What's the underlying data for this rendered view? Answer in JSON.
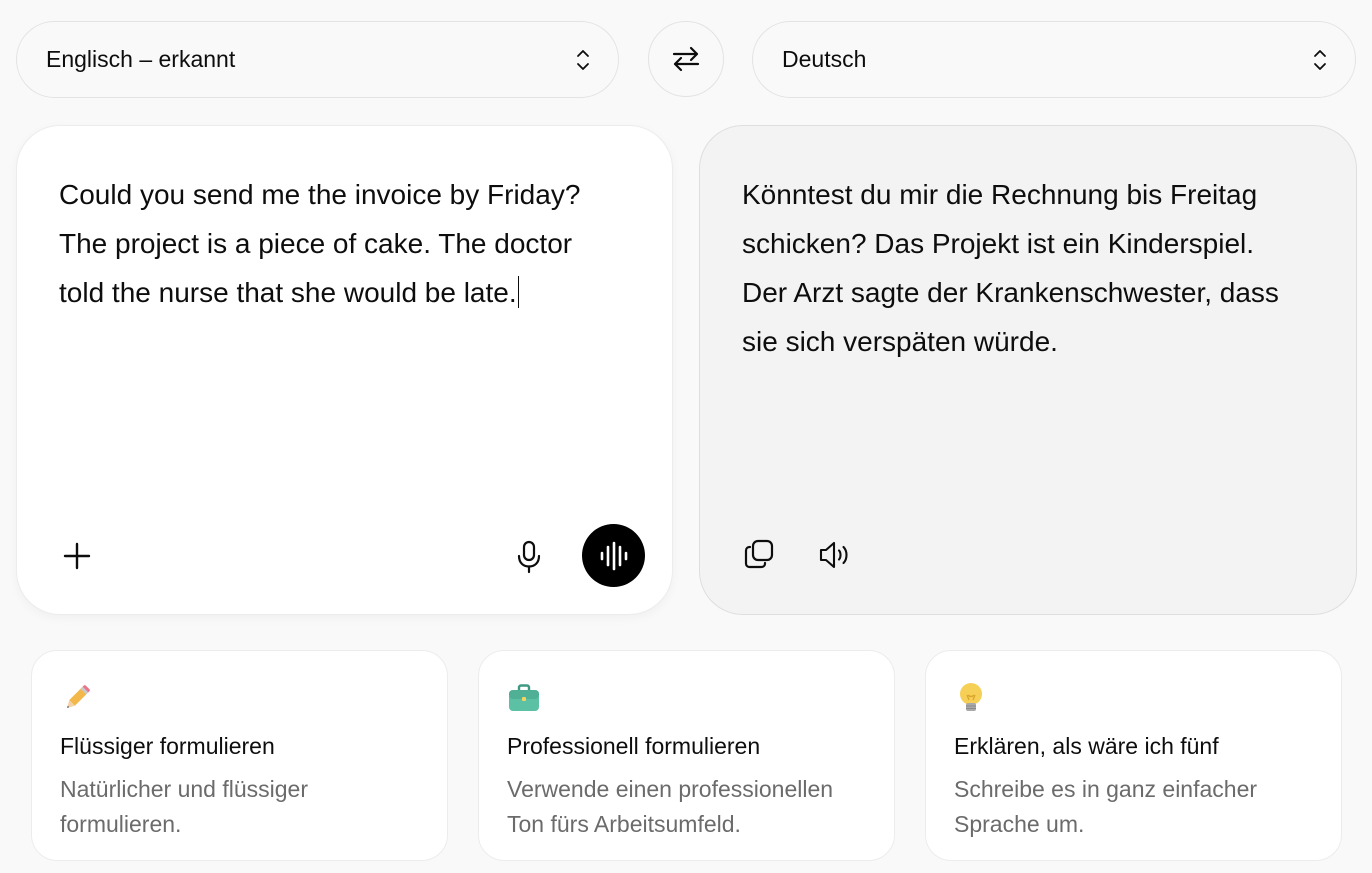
{
  "source_language": {
    "label": "Englisch – erkannt",
    "icon": "chevron-up-down-icon"
  },
  "target_language": {
    "label": "Deutsch",
    "icon": "chevron-up-down-icon"
  },
  "swap": {
    "icon": "swap-arrows-icon"
  },
  "source_panel": {
    "text": "Could you send me the invoice by Friday?\nThe project is a piece of cake. The doctor\ntold the nurse that she would be late.",
    "icons": [
      "plus-icon",
      "microphone-icon",
      "voice-waveform-icon"
    ]
  },
  "target_panel": {
    "text": "Könntest du mir die Rechnung bis Freitag\nschicken? Das Projekt ist ein Kinderspiel.\nDer Arzt sagte der Krankenschwester, dass\nsie sich verspäten würde.",
    "icons": [
      "copy-icon",
      "speaker-icon"
    ]
  },
  "suggestions": [
    {
      "icon": "pencil-icon",
      "title": "Flüssiger formulieren",
      "description": "Natürlicher und flüssiger\nformulieren."
    },
    {
      "icon": "briefcase-icon",
      "title": "Professionell formulieren",
      "description": "Verwende einen professionellen\nTon fürs Arbeitsumfeld."
    },
    {
      "icon": "lightbulb-icon",
      "title": "Erklären, als wäre ich fünf",
      "description": "Schreibe es in ganz einfacher\nSprache um."
    }
  ],
  "colors": {
    "background": "#f9f9f9",
    "source_panel": "#ffffff",
    "target_panel": "#f3f3f3",
    "voice_button": "#000000",
    "secondary_text": "#6b6b6b"
  }
}
